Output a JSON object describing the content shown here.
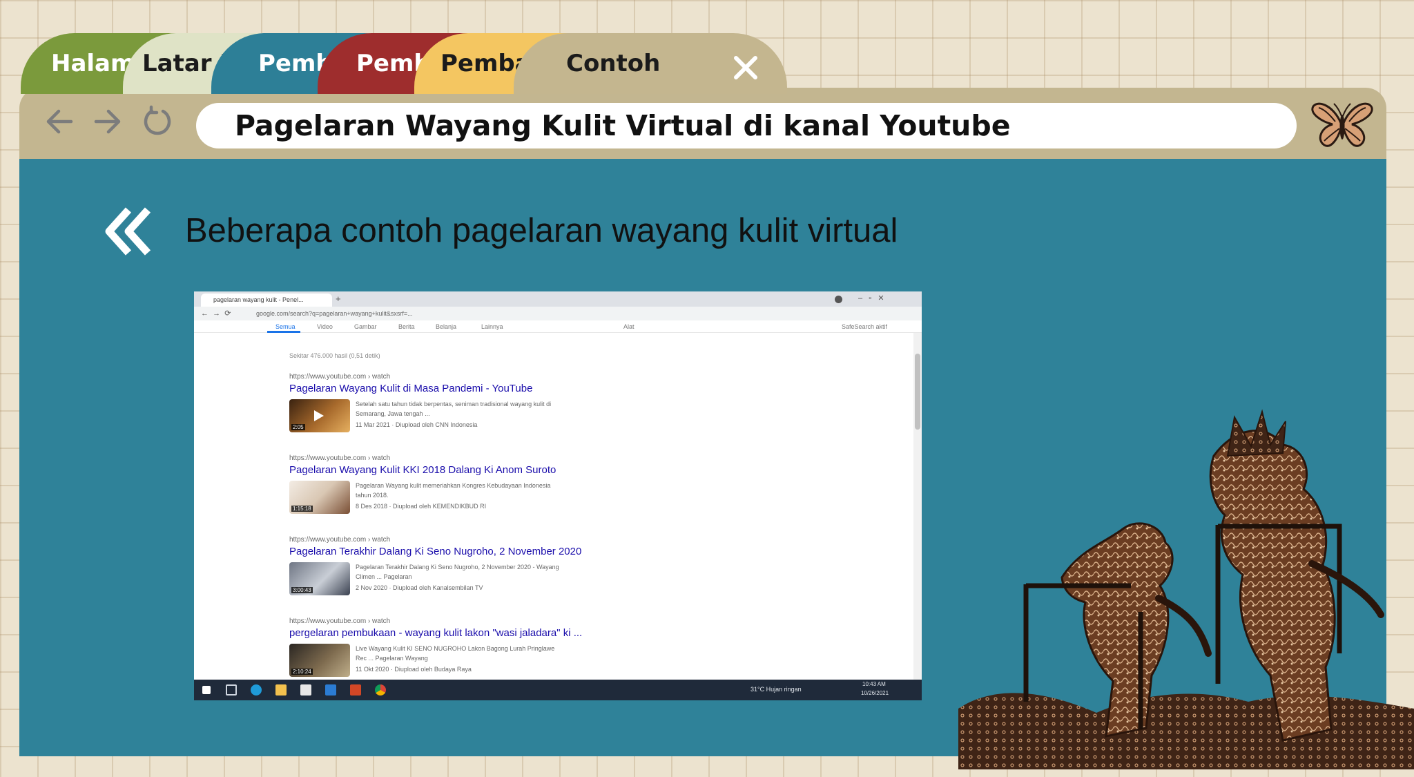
{
  "tabs": [
    {
      "label": "Halaman",
      "color": "#7b9a3c",
      "text_color": "#ffffff"
    },
    {
      "label": "Latar Belakang",
      "color": "#dfe3c6",
      "text_color": "#1b1b1b"
    },
    {
      "label": "Pembahasan",
      "color": "#2d7f97",
      "text_color": "#ffffff"
    },
    {
      "label": "Pembahasan",
      "color": "#9e2d2d",
      "text_color": "#ffffff"
    },
    {
      "label": "Pembahasan",
      "color": "#f4c661",
      "text_color": "#1b1b1b"
    },
    {
      "label": "Contoh",
      "color": "#c4b68f",
      "text_color": "#1b1b1b"
    }
  ],
  "close_icon": "close-icon",
  "toolbar": {
    "back_icon": "arrow-left-icon",
    "forward_icon": "arrow-right-icon",
    "reload_icon": "reload-icon",
    "address": "Pagelaran Wayang Kulit Virtual di kanal Youtube",
    "logo_icon": "butterfly-icon"
  },
  "main": {
    "back_icon": "double-chevron-left-icon",
    "heading": "Beberapa contoh pagelaran wayang kulit virtual"
  },
  "screenshot": {
    "tab_title": "pagelaran wayang kulit - Penel...",
    "url": "google.com/search?q=pagelaran+wayang+kulit&sxsrf=...",
    "filters": [
      "Semua",
      "Video",
      "Gambar",
      "Berita",
      "Belanja",
      "Lainnya",
      "Alat"
    ],
    "safesearch": "SafeSearch aktif",
    "result_count": "Sekitar 476.000 hasil (0,51 detik)",
    "results": [
      {
        "url": "https://www.youtube.com › watch",
        "title": "Pagelaran Wayang Kulit di Masa Pandemi - YouTube",
        "duration": "2:05",
        "snippet1": "Setelah satu tahun tidak berpentas, seniman tradisional wayang kulit di",
        "snippet2": "Semarang, Jawa tengah ...",
        "snippet3": "11 Mar 2021 · Diupload oleh CNN Indonesia"
      },
      {
        "url": "https://www.youtube.com › watch",
        "title": "Pagelaran Wayang Kulit KKI 2018 Dalang Ki Anom Suroto",
        "duration": "1:15:18",
        "snippet1": "Pagelaran Wayang kulit memeriahkan Kongres Kebudayaan Indonesia",
        "snippet2": "tahun 2018.",
        "snippet3": "8 Des 2018 · Diupload oleh KEMENDIKBUD RI"
      },
      {
        "url": "https://www.youtube.com › watch",
        "title": "Pagelaran Terakhir Dalang Ki Seno Nugroho, 2 November 2020",
        "duration": "3:00:43",
        "snippet1": "Pagelaran Terakhir Dalang Ki Seno Nugroho, 2 November 2020 - Wayang",
        "snippet2": "Climen ... Pagelaran",
        "snippet3": "2 Nov 2020 · Diupload oleh Kanalsembilan TV"
      },
      {
        "url": "https://www.youtube.com › watch",
        "title": "pergelaran pembukaan - wayang kulit lakon \"wasi jaladara\" ki ...",
        "duration": "2:10:24",
        "snippet1": "Live Wayang Kulit KI SENO NUGROHO Lakon Bagong Lurah Pringlawe",
        "snippet2": "Rec ... Pagelaran Wayang",
        "snippet3": "11 Okt 2020 · Diupload oleh Budaya Raya"
      }
    ],
    "taskbar": {
      "weather": "31°C  Hujan ringan",
      "time": "10:43 AM",
      "date": "10/26/2021"
    }
  },
  "decoration": {
    "puppet_icon": "wayang-kulit-puppets-icon"
  }
}
